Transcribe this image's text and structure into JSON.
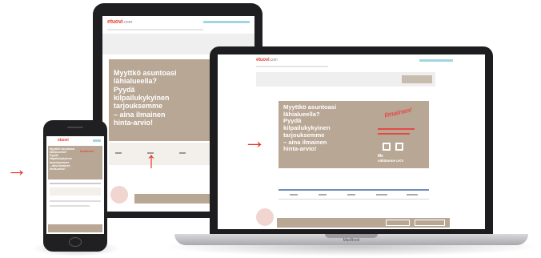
{
  "site": {
    "logo": "etuovi",
    "logo_suffix": ".com",
    "hero_lines": "Myyttkö asuntoasi\nlähialueella?\nPyydä\nkilpailukykyinen\ntarjouksemme\n– aina ilmainen\nhinta-arvio!",
    "hero_tag": "Ilmainen!",
    "badge_line1": "Me",
    "badge_line2": "välitämme LKV",
    "device_label": "MacBook"
  },
  "colors": {
    "hero_background": "#b8a795",
    "accent_red": "#e34a44",
    "arrow_red": "#e5372c",
    "contact_blue": "#2ba8c4"
  },
  "arrows": {
    "phone_arrow": "→",
    "tablet_arrow": "↑",
    "laptop_arrow": "→"
  }
}
